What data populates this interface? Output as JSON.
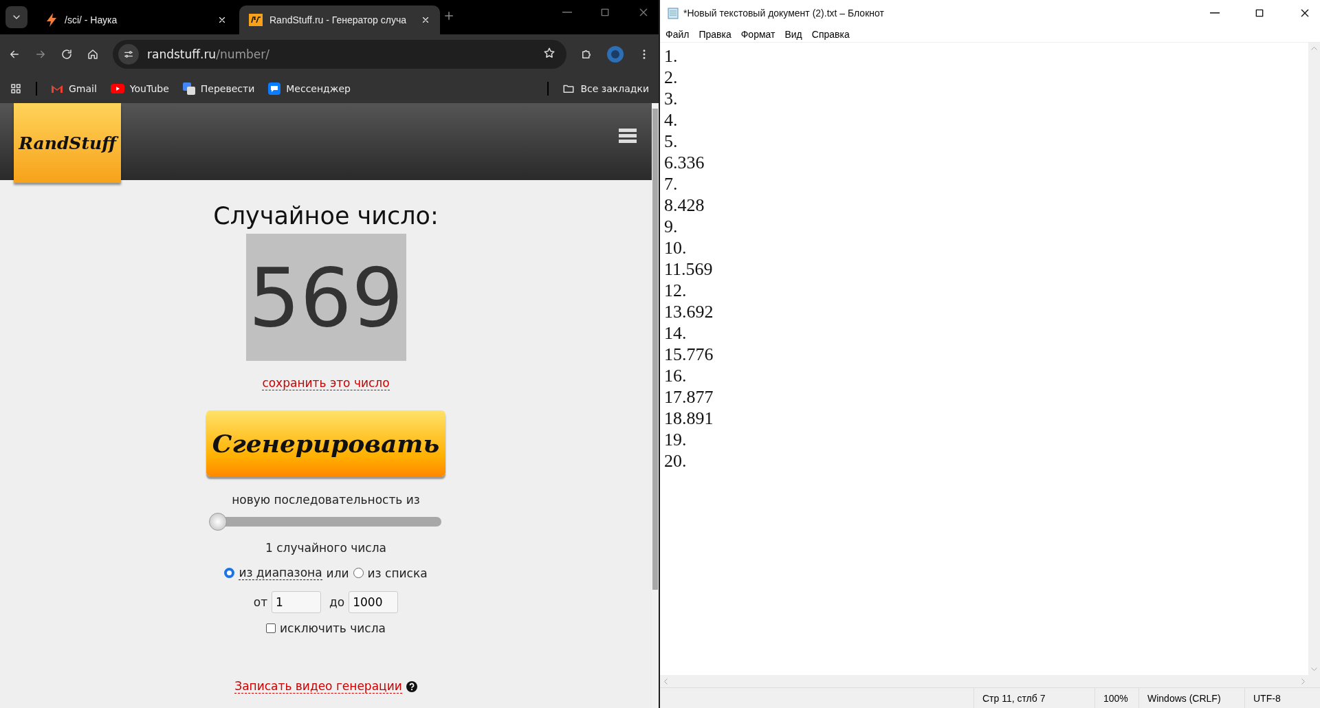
{
  "browser": {
    "tabs": [
      {
        "title": "/sci/ - Наука",
        "selected": false
      },
      {
        "title": "RandStuff.ru - Генератор случа",
        "selected": true
      }
    ],
    "address": {
      "host": "randstuff.ru",
      "path": "/number/"
    },
    "bookmarks": [
      {
        "label": "Gmail",
        "kind": "gmail"
      },
      {
        "label": "YouTube",
        "kind": "youtube"
      },
      {
        "label": "Перевести",
        "kind": "translate"
      },
      {
        "label": "Мессенджер",
        "kind": "messenger"
      }
    ],
    "all_bookmarks": "Все закладки"
  },
  "site": {
    "logo": "RandStuff",
    "heading": "Случайное число:",
    "number": "569",
    "save_link": "сохранить это число",
    "generate_button": "Сгенерировать",
    "sequence_label": "новую последовательность из",
    "slider": {
      "level": 0
    },
    "count_label": "1 случайного числа",
    "modes": [
      {
        "label": "из диапазона",
        "selected": true
      },
      {
        "label": "из списка",
        "selected": false
      }
    ],
    "mode_joiner": "или",
    "from_label": "от",
    "from_value": "1",
    "to_label": "до",
    "to_value": "1000",
    "exclude": {
      "label": "исключить числа",
      "checked": false
    },
    "video_link": "Записать видео генерации"
  },
  "notepad": {
    "title": "*Новый текстовый документ (2).txt – Блокнот",
    "menu": [
      "Файл",
      "Правка",
      "Формат",
      "Вид",
      "Справка"
    ],
    "lines": [
      "1.",
      "2.",
      "3.",
      "4.",
      "5.",
      "6.336",
      "7.",
      "8.428",
      "9.",
      "10.",
      "11.569",
      "12.",
      "13.692",
      "14.",
      "15.776",
      "16.",
      "17.877",
      "18.891",
      "19.",
      "20."
    ],
    "status": [
      "Стр 11, стлб 7",
      "100%",
      "Windows (CRLF)",
      "UTF-8"
    ]
  }
}
